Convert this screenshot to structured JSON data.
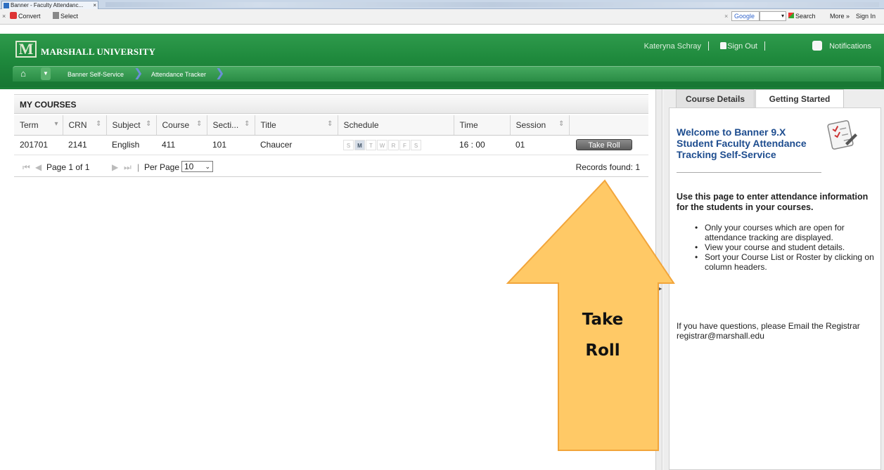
{
  "browser": {
    "tab_title": "Banner - Faculty Attendanc...",
    "tab_close": "×",
    "toolbar": {
      "close_x": "×",
      "convert": "Convert",
      "select": "Select",
      "google_x": "×",
      "google": "Google",
      "search": "Search",
      "more": "More »",
      "signin": "Sign In"
    }
  },
  "header": {
    "logo_mark": "M",
    "university": "MARSHALL UNIVERSITY",
    "user": "Kateryna Schray",
    "sign_out": "Sign Out",
    "notifications": "Notifications",
    "home_icon": "⌂",
    "menu_icon": "▼",
    "breadcrumbs": [
      "Banner Self-Service",
      "Attendance Tracker"
    ],
    "crumb_arrow": "❯"
  },
  "courses": {
    "title": "MY COURSES",
    "columns": [
      {
        "label": "Term",
        "sort": "▾"
      },
      {
        "label": "CRN",
        "sort": "⇕"
      },
      {
        "label": "Subject",
        "sort": "⇕"
      },
      {
        "label": "Course",
        "sort": "⇕"
      },
      {
        "label": "Secti...",
        "sort": "⇕"
      },
      {
        "label": "Title",
        "sort": "⇕"
      },
      {
        "label": "Schedule",
        "sort": ""
      },
      {
        "label": "Time",
        "sort": ""
      },
      {
        "label": "Session",
        "sort": "⇕"
      },
      {
        "label": "",
        "sort": ""
      }
    ],
    "row": {
      "term": "201701",
      "crn": "2141",
      "subject": "English",
      "course": "411",
      "section": "101",
      "title": "Chaucer",
      "days": [
        {
          "label": "S",
          "active": false
        },
        {
          "label": "M",
          "active": true
        },
        {
          "label": "T",
          "active": false
        },
        {
          "label": "W",
          "active": false
        },
        {
          "label": "R",
          "active": false
        },
        {
          "label": "F",
          "active": false
        },
        {
          "label": "S",
          "active": false
        }
      ],
      "time": "16 : 00",
      "session": "01",
      "action": "Take Roll"
    },
    "pager": {
      "first": "⏮",
      "prev": "◀",
      "page_text": "Page  1 of 1",
      "next": "▶",
      "last": "⏭",
      "separator": "|",
      "per_page_label": "Per Page",
      "per_page_value": "10",
      "per_page_caret": "⌄",
      "records": "Records found: 1"
    }
  },
  "right_panel": {
    "splitter_arrow": "▶",
    "tabs": [
      "Course Details",
      "Getting Started"
    ],
    "welcome": "Welcome to Banner 9.X Student Faculty Attendance Tracking Self-Service",
    "intro": "Use this page to enter attendance information for the students in your courses.",
    "bullets": [
      "Only your courses which are open for attendance tracking are displayed.",
      "View your course and student details.",
      "Sort your Course List or Roster by clicking on column headers."
    ],
    "questions": "If you have questions, please Email the Registrar registrar@marshall.edu"
  },
  "annotation": {
    "label_line1": "Take",
    "label_line2": "Roll",
    "fill": "#FFC966",
    "stroke": "#F2A53A"
  }
}
